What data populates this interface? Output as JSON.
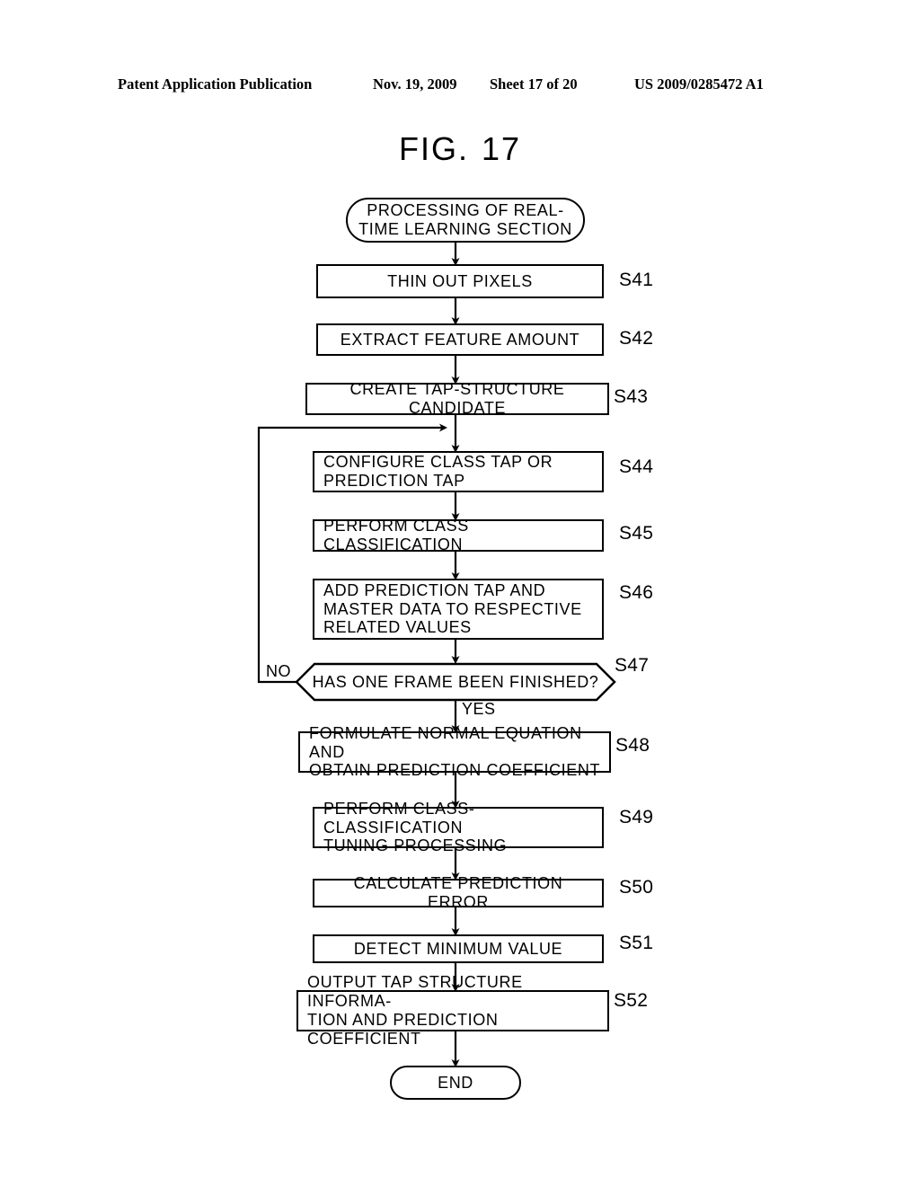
{
  "header": {
    "publication": "Patent Application Publication",
    "date": "Nov. 19, 2009",
    "sheet": "Sheet 17 of 20",
    "doc_number": "US 2009/0285472 A1"
  },
  "figure": {
    "label": "FIG.",
    "number": "17"
  },
  "flowchart": {
    "start": {
      "text": "PROCESSING OF REAL-\nTIME LEARNING SECTION"
    },
    "end": {
      "text": "END"
    },
    "steps": [
      {
        "code": "S41",
        "text": "THIN OUT PIXELS",
        "align": "center"
      },
      {
        "code": "S42",
        "text": "EXTRACT FEATURE AMOUNT",
        "align": "center"
      },
      {
        "code": "S43",
        "text": "CREATE TAP-STRUCTURE CANDIDATE",
        "align": "center"
      },
      {
        "code": "S44",
        "text": "CONFIGURE CLASS TAP OR\nPREDICTION TAP",
        "align": "left"
      },
      {
        "code": "S45",
        "text": "PERFORM CLASS CLASSIFICATION",
        "align": "left"
      },
      {
        "code": "S46",
        "text": "ADD PREDICTION TAP AND\nMASTER DATA TO RESPECTIVE\nRELATED VALUES",
        "align": "left"
      },
      {
        "code": "S48",
        "text": "FORMULATE NORMAL EQUATION AND\nOBTAIN PREDICTION COEFFICIENT",
        "align": "left"
      },
      {
        "code": "S49",
        "text": "PERFORM CLASS-CLASSIFICATION\nTUNING PROCESSING",
        "align": "left"
      },
      {
        "code": "S50",
        "text": "CALCULATE PREDICTION ERROR",
        "align": "center"
      },
      {
        "code": "S51",
        "text": "DETECT MINIMUM VALUE",
        "align": "center"
      },
      {
        "code": "S52",
        "text": "OUTPUT TAP STRUCTURE INFORMA-\nTION AND PREDICTION COEFFICIENT",
        "align": "left"
      }
    ],
    "decision": {
      "code": "S47",
      "text": "HAS ONE FRAME BEEN FINISHED?",
      "yes_label": "YES",
      "no_label": "NO"
    }
  },
  "colors": {
    "ink": "#000000",
    "paper": "#ffffff"
  }
}
